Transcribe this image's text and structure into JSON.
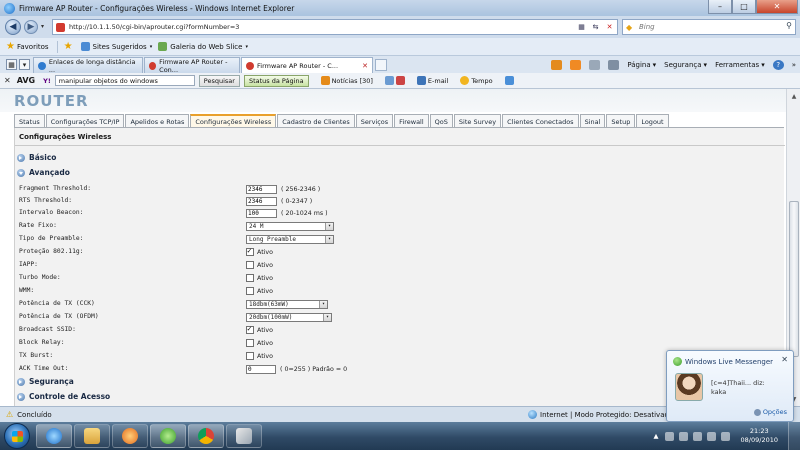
{
  "window": {
    "title": "Firmware AP Router - Configurações Wireless - Windows Internet Explorer",
    "minimize_glyph": "–",
    "maximize_glyph": "□",
    "close_glyph": "✕"
  },
  "address_bar": {
    "url": "http://10.1.1.50/cgi-bin/aprouter.cgi?formNumber=3",
    "search_placeholder": "Bing",
    "back_glyph": "◀",
    "forward_glyph": "▶",
    "dropdown_glyph": "▾",
    "compat_glyph": "▦",
    "refresh_glyph": "⇆",
    "stop_glyph": "✕",
    "search_glyph": "⚲"
  },
  "favorites_bar": {
    "favorites_label": "Favoritos",
    "items": [
      "Sites Sugeridos",
      "Galeria do Web Slice"
    ],
    "caret_glyph": "▾"
  },
  "tabs": {
    "items": [
      {
        "label": "Enlaces de longa distância ..."
      },
      {
        "label": "Firmware AP Router - Con..."
      },
      {
        "label": "Firmware AP Router - C..."
      }
    ],
    "close_glyph": "✕",
    "quick_tabs_glyph": "▦",
    "tab_list_glyph": "▾"
  },
  "command_bar": {
    "items": [
      "Página",
      "Segurança",
      "Ferramentas"
    ],
    "help_glyph": "?",
    "overflow_glyph": "»"
  },
  "avg_toolbar": {
    "close_glyph": "✕",
    "logo": "AVG",
    "yahoo": "Y!",
    "search_value": "manipular objetos do windows",
    "search_button": "Pesquisar",
    "status_button": "Status da Página",
    "news": "Notícias [30]",
    "email": "E-mail",
    "weather": "Tempo"
  },
  "router": {
    "logo": "ROUTER",
    "nav_tabs": [
      "Status",
      "Configurações TCP/IP",
      "Apelidos e Rotas",
      "Configurações Wireless",
      "Cadastro de Clientes",
      "Serviços",
      "Firewall",
      "QoS",
      "Site Survey",
      "Clientes Conectados",
      "Sinal",
      "Setup",
      "Logout"
    ],
    "active_tab": "Configurações Wireless",
    "page_title": "Configurações Wireless",
    "sections": {
      "basico": "Básico",
      "avancado": "Avançado",
      "seguranca": "Segurança",
      "controle": "Controle de Acesso"
    },
    "fields": {
      "frag": {
        "label": "Fragment Threshold:",
        "value": "2346",
        "hint": "( 256-2346 )"
      },
      "rts": {
        "label": "RTS Threshold:",
        "value": "2346",
        "hint": "( 0-2347 )"
      },
      "beacon": {
        "label": "Intervalo Beacon:",
        "value": "100",
        "hint": "( 20-1024 ms )"
      },
      "rate": {
        "label": "Rate Fixo:",
        "value": "24 M"
      },
      "preamble": {
        "label": "Tipo de Preamble:",
        "value": "Long Preamble"
      },
      "protecao": {
        "label": "Proteção 802.11g:",
        "checked": true,
        "text": "Ativo"
      },
      "iapp": {
        "label": "IAPP:",
        "checked": false,
        "text": "Ativo"
      },
      "turbo": {
        "label": "Turbo Mode:",
        "checked": false,
        "text": "Ativo"
      },
      "wmm": {
        "label": "WMM:",
        "checked": false,
        "text": "Ativo"
      },
      "cck": {
        "label": "Potência de TX (CCK)",
        "value": "18dbm(63mW)"
      },
      "ofdm": {
        "label": "Potência de TX (OFDM)",
        "value": "20dbm(100mW)"
      },
      "ssid": {
        "label": "Broadcast SSID:",
        "checked": true,
        "text": "Ativo"
      },
      "relay": {
        "label": "Block Relay:",
        "checked": false,
        "text": "Ativo"
      },
      "burst": {
        "label": "TX Burst:",
        "checked": false,
        "text": "Ativo"
      },
      "ack": {
        "label": "ACK Time Out:",
        "value": "0",
        "hint": "( 0=255 ) Padrão = 0"
      }
    },
    "dropdown_glyph": "▾"
  },
  "status_bar": {
    "text": "Concluído",
    "zone": "Internet | Modo Protegido: Desativado",
    "warn_glyph": "⚠"
  },
  "messenger": {
    "title": "Windows Live Messenger",
    "message_line1": "[c=4]Thaii... diz:",
    "message_line2": "kaka",
    "options": "Opções",
    "close_glyph": "✕"
  },
  "taskbar": {
    "time": "21:23",
    "date": "08/09/2010"
  }
}
